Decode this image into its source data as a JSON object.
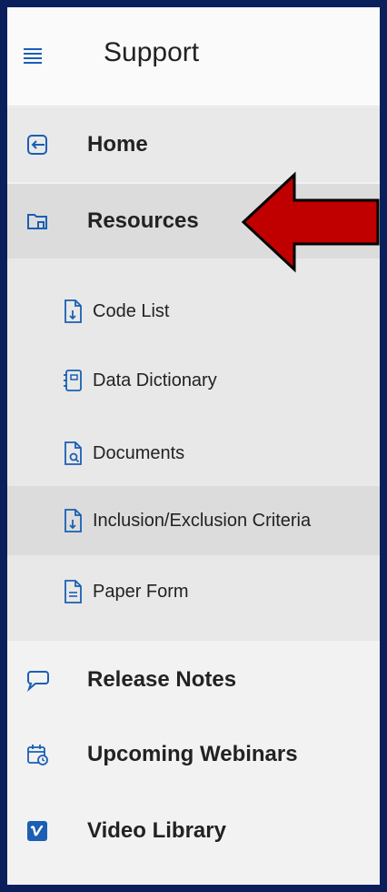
{
  "header": {
    "title": "Support",
    "menu_icon": "hamburger-icon"
  },
  "nav": {
    "home": {
      "label": "Home",
      "icon": "arrow-left-box-icon"
    },
    "resources": {
      "label": "Resources",
      "icon": "folder-icon",
      "items": [
        {
          "label": "Code List",
          "icon": "document-download-icon"
        },
        {
          "label": "Data Dictionary",
          "icon": "notebook-icon"
        },
        {
          "label": "Documents",
          "icon": "document-search-icon"
        },
        {
          "label": "Inclusion/Exclusion Criteria",
          "icon": "document-download-icon"
        },
        {
          "label": "Paper Form",
          "icon": "document-lines-icon"
        }
      ]
    },
    "release_notes": {
      "label": "Release Notes",
      "icon": "chat-bubble-icon"
    },
    "upcoming_webinars": {
      "label": "Upcoming Webinars",
      "icon": "calendar-clock-icon"
    },
    "video_library": {
      "label": "Video Library",
      "icon": "vimeo-icon"
    }
  },
  "colors": {
    "frame": "#0b1f5c",
    "icon_blue": "#1a5fb4",
    "arrow_red": "#c00000"
  }
}
